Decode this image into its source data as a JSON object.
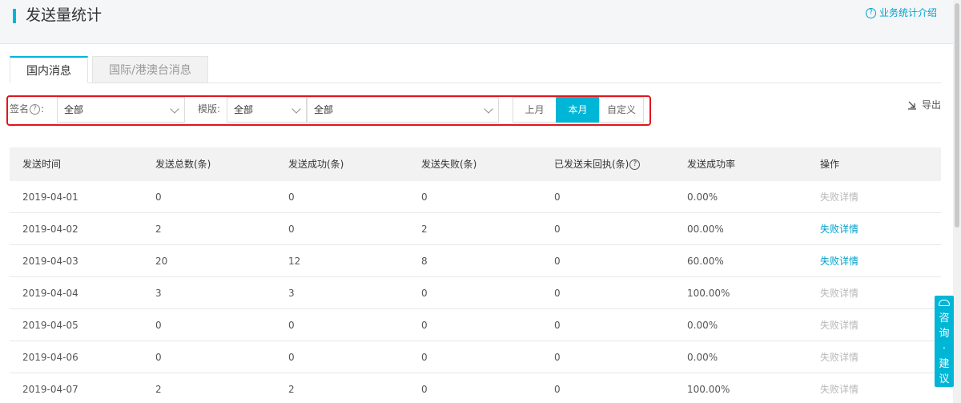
{
  "header": {
    "title": "发送量统计",
    "help_label": "业务统计介绍",
    "help_icon": "question-circle-icon"
  },
  "tabs": [
    {
      "label": "国内消息",
      "active": true
    },
    {
      "label": "国际/港澳台消息",
      "active": false
    }
  ],
  "filters": {
    "sign_label": "签名",
    "sign_value": "全部",
    "template_label": "模版:",
    "template_type_value": "全部",
    "template_value": "全部",
    "periods": [
      {
        "label": "上月",
        "active": false
      },
      {
        "label": "本月",
        "active": true
      },
      {
        "label": "自定义",
        "active": false
      }
    ],
    "export_label": "导出"
  },
  "table": {
    "columns": [
      "发送时间",
      "发送总数(条)",
      "发送成功(条)",
      "发送失败(条)",
      "已发送未回执(条)",
      "发送成功率",
      "操作"
    ],
    "rows": [
      {
        "date": "2019-04-01",
        "total": "0",
        "success": "0",
        "failed": "0",
        "pending": "0",
        "rate": "0.00%",
        "action": "失败详情",
        "action_enabled": false
      },
      {
        "date": "2019-04-02",
        "total": "2",
        "success": "0",
        "failed": "2",
        "pending": "0",
        "rate": "00.00%",
        "action": "失败详情",
        "action_enabled": true
      },
      {
        "date": "2019-04-03",
        "total": "20",
        "success": "12",
        "failed": "8",
        "pending": "0",
        "rate": "60.00%",
        "action": "失败详情",
        "action_enabled": true
      },
      {
        "date": "2019-04-04",
        "total": "3",
        "success": "3",
        "failed": "0",
        "pending": "0",
        "rate": "100.00%",
        "action": "失败详情",
        "action_enabled": false
      },
      {
        "date": "2019-04-05",
        "total": "0",
        "success": "0",
        "failed": "0",
        "pending": "0",
        "rate": "0.00%",
        "action": "失败详情",
        "action_enabled": false
      },
      {
        "date": "2019-04-06",
        "total": "0",
        "success": "0",
        "failed": "0",
        "pending": "0",
        "rate": "0.00%",
        "action": "失败详情",
        "action_enabled": false
      },
      {
        "date": "2019-04-07",
        "total": "2",
        "success": "2",
        "failed": "0",
        "pending": "0",
        "rate": "100.00%",
        "action": "失败详情",
        "action_enabled": false
      }
    ]
  },
  "consult": {
    "chars": [
      "咨",
      "询",
      "·",
      "建",
      "议"
    ]
  },
  "colors": {
    "accent": "#00b6d6",
    "link": "#00a2ca",
    "highlight_border": "#e0161d",
    "disabled_link": "#b8b8b8"
  }
}
